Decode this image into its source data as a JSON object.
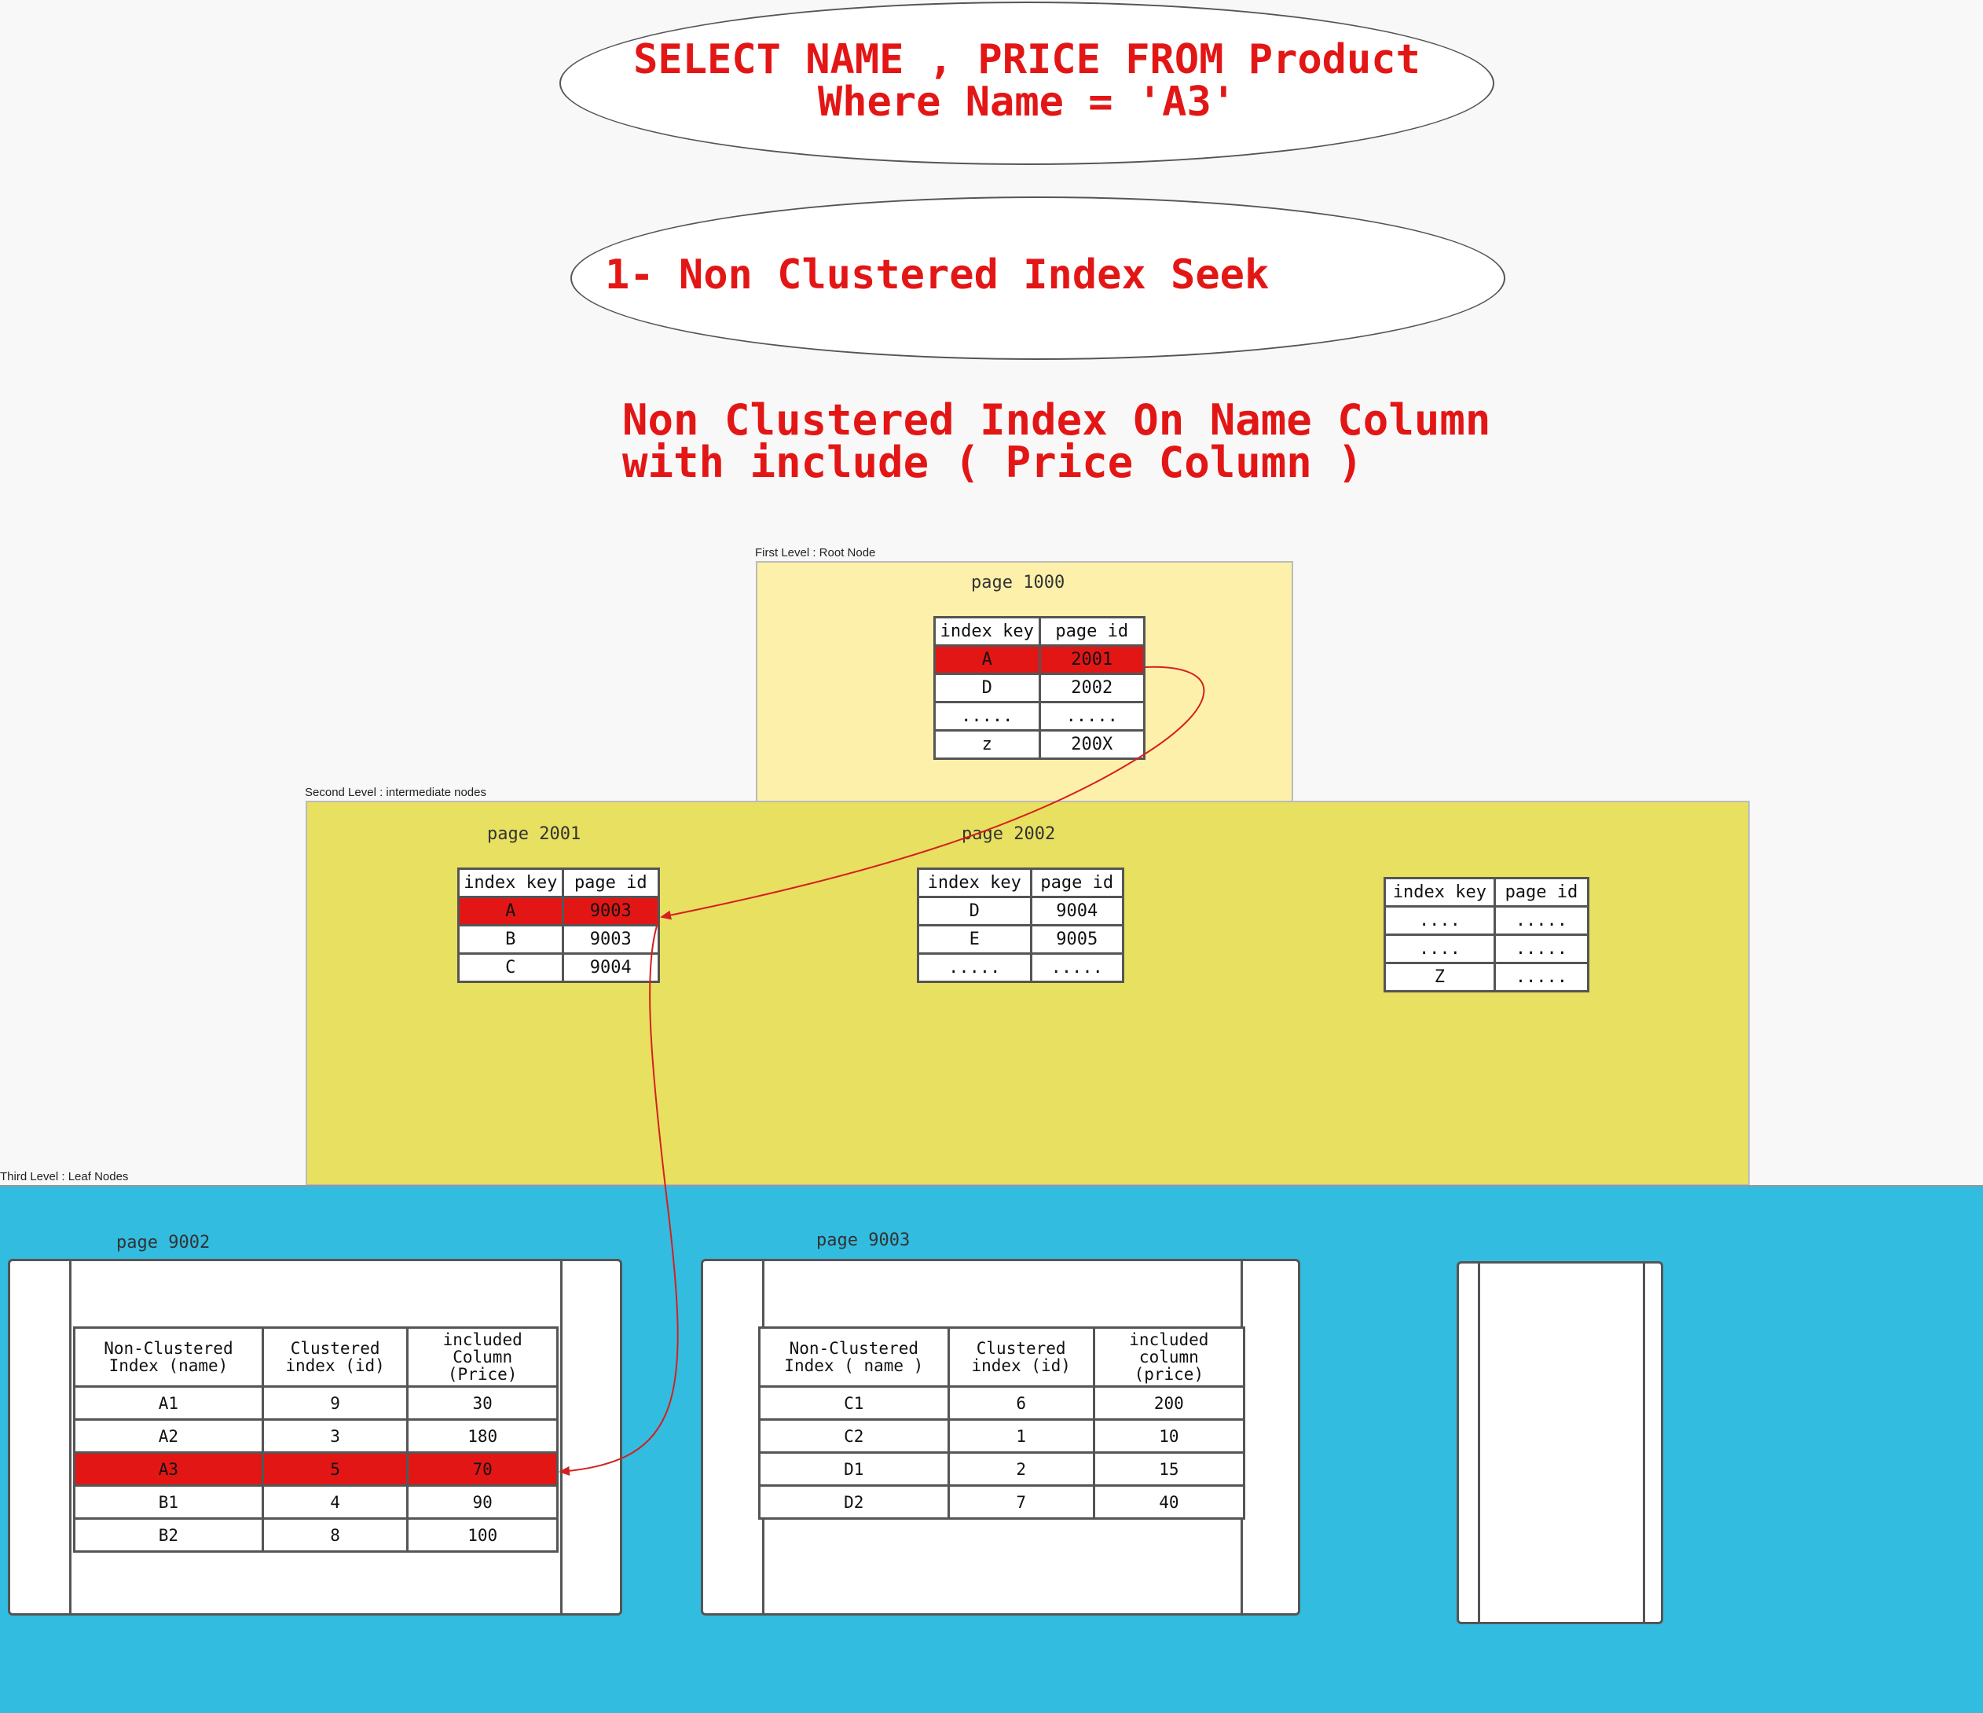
{
  "query": {
    "line1": "SELECT NAME , PRICE FROM Product",
    "line2": "Where Name = 'A3'"
  },
  "step": {
    "label": "1- Non Clustered Index Seek"
  },
  "index_desc": {
    "line1": "Non Clustered Index On Name Column",
    "line2": "with include ( Price Column )"
  },
  "root_level": {
    "label": "First Level : Root Node",
    "page_label": "page 1000",
    "headers": [
      "index key",
      "page id"
    ],
    "rows": [
      [
        "A",
        "2001"
      ],
      [
        "D",
        "2002"
      ],
      [
        ".....",
        "....."
      ],
      [
        "z",
        "200X"
      ]
    ],
    "highlight_row": 0
  },
  "intermediate_level": {
    "label": "Second Level : intermediate nodes",
    "pages": [
      {
        "page_label": "page 2001",
        "headers": [
          "index key",
          "page id"
        ],
        "rows": [
          [
            "A",
            "9003"
          ],
          [
            "B",
            "9003"
          ],
          [
            "C",
            "9004"
          ]
        ],
        "highlight_row": 0
      },
      {
        "page_label": "page 2002",
        "headers": [
          "index key",
          "page id"
        ],
        "rows": [
          [
            "D",
            "9004"
          ],
          [
            "E",
            "9005"
          ],
          [
            ".....",
            "....."
          ]
        ]
      },
      {
        "page_label": "",
        "headers": [
          "index key",
          "page id"
        ],
        "rows": [
          [
            "....",
            "....."
          ],
          [
            "....",
            "....."
          ],
          [
            "Z",
            "....."
          ]
        ]
      }
    ]
  },
  "leaf_level": {
    "label": "Third Level : Leaf Nodes",
    "pages": [
      {
        "page_label": "page 9002",
        "headers": [
          "Non-Clustered\nIndex (name)",
          "Clustered\nindex (id)",
          "included\nColumn\n(Price)"
        ],
        "rows": [
          [
            "A1",
            "9",
            "30"
          ],
          [
            "A2",
            "3",
            "180"
          ],
          [
            "A3",
            "5",
            "70"
          ],
          [
            "B1",
            "4",
            "90"
          ],
          [
            "B2",
            "8",
            "100"
          ]
        ],
        "highlight_row": 2
      },
      {
        "page_label": "page 9003",
        "headers": [
          "Non-Clustered\nIndex ( name )",
          "Clustered\nindex (id)",
          "included\ncolumn\n(price)"
        ],
        "rows": [
          [
            "C1",
            "6",
            "200"
          ],
          [
            "C2",
            "1",
            "10"
          ],
          [
            "D1",
            "2",
            "15"
          ],
          [
            "D2",
            "7",
            "40"
          ]
        ]
      }
    ]
  },
  "colors": {
    "highlight": "#e31616",
    "root_fill": "#fdf0aa",
    "intermediate_fill": "#e8e060",
    "leaf_fill": "#32bce0",
    "arrow": "#d42020"
  }
}
